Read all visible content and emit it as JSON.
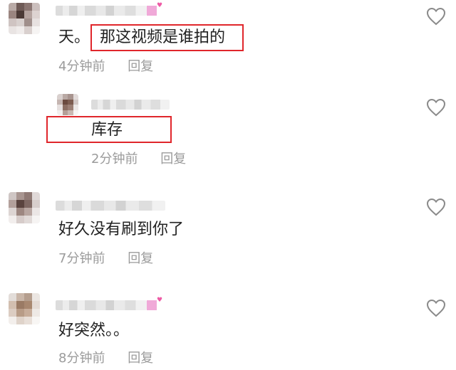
{
  "comments": [
    {
      "text_prefix": "天。",
      "text_highlight": "那这视频是谁拍的",
      "time": "4分钟前",
      "reply": "回复"
    },
    {
      "text_highlight": "库存",
      "time": "2分钟前",
      "reply": "回复"
    },
    {
      "text": "好久没有刷到你了",
      "time": "7分钟前",
      "reply": "回复"
    },
    {
      "text": "好突然。。",
      "time": "8分钟前",
      "reply": "回复"
    }
  ],
  "icons": {
    "like": "heart-outline-icon"
  },
  "colors": {
    "highlight_box": "#e0262b",
    "meta_text": "#9b9b9b",
    "badge": "#f0a9d8"
  }
}
